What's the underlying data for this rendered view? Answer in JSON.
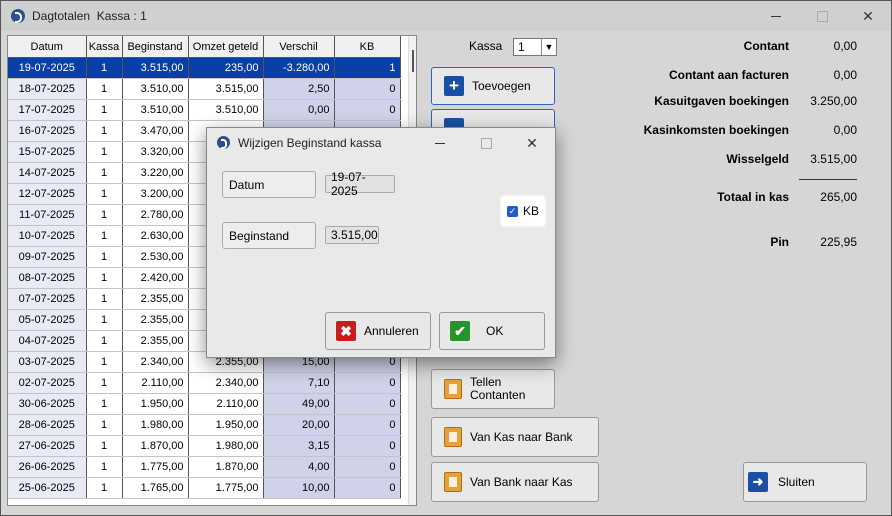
{
  "window": {
    "title": "Dagtotalen",
    "subtitle": "Kassa : 1",
    "minimize_symbol": "—",
    "maximize_symbol": "☐",
    "close_symbol": "✕"
  },
  "grid": {
    "columns": [
      "Datum",
      "Kassa",
      "Beginstand",
      "Omzet geteld",
      "Verschil",
      "KB"
    ],
    "rows": [
      [
        "19-07-2025",
        "1",
        "3.515,00",
        "235,00",
        "-3.280,00",
        "1"
      ],
      [
        "18-07-2025",
        "1",
        "3.510,00",
        "3.515,00",
        "2,50",
        "0"
      ],
      [
        "17-07-2025",
        "1",
        "3.510,00",
        "3.510,00",
        "0,00",
        "0"
      ],
      [
        "16-07-2025",
        "1",
        "3.470,00",
        "",
        "",
        ""
      ],
      [
        "15-07-2025",
        "1",
        "3.320,00",
        "",
        "",
        ""
      ],
      [
        "14-07-2025",
        "1",
        "3.220,00",
        "",
        "",
        ""
      ],
      [
        "12-07-2025",
        "1",
        "3.200,00",
        "",
        "",
        ""
      ],
      [
        "11-07-2025",
        "1",
        "2.780,00",
        "",
        "",
        ""
      ],
      [
        "10-07-2025",
        "1",
        "2.630,00",
        "",
        "",
        ""
      ],
      [
        "09-07-2025",
        "1",
        "2.530,00",
        "",
        "",
        ""
      ],
      [
        "08-07-2025",
        "1",
        "2.420,00",
        "",
        "",
        ""
      ],
      [
        "07-07-2025",
        "1",
        "2.355,00",
        "",
        "",
        ""
      ],
      [
        "05-07-2025",
        "1",
        "2.355,00",
        "",
        "",
        ""
      ],
      [
        "04-07-2025",
        "1",
        "2.355,00",
        "",
        "",
        ""
      ],
      [
        "03-07-2025",
        "1",
        "2.340,00",
        "2.355,00",
        "15,00",
        "0"
      ],
      [
        "02-07-2025",
        "1",
        "2.110,00",
        "2.340,00",
        "7,10",
        "0"
      ],
      [
        "30-06-2025",
        "1",
        "1.950,00",
        "2.110,00",
        "49,00",
        "0"
      ],
      [
        "28-06-2025",
        "1",
        "1.980,00",
        "1.950,00",
        "20,00",
        "0"
      ],
      [
        "27-06-2025",
        "1",
        "1.870,00",
        "1.980,00",
        "3,15",
        "0"
      ],
      [
        "26-06-2025",
        "1",
        "1.775,00",
        "1.870,00",
        "4,00",
        "0"
      ],
      [
        "25-06-2025",
        "1",
        "1.765,00",
        "1.775,00",
        "10,00",
        "0"
      ]
    ]
  },
  "kassa_select": {
    "label": "Kassa",
    "value": "1"
  },
  "buttons": {
    "toevoegen": "Toevoegen",
    "tellen_line1": "Tellen",
    "tellen_line2": "Contanten",
    "kas_naar_bank": "Van Kas naar Bank",
    "bank_naar_kas": "Van Bank naar Kas",
    "sluiten": "Sluiten"
  },
  "summary": [
    {
      "label": "Contant",
      "value": "0,00"
    },
    {
      "label": "Contant aan facturen",
      "value": "0,00"
    },
    {
      "label": "Kasuitgaven boekingen",
      "value": "3.250,00"
    },
    {
      "label": "Kasinkomsten boekingen",
      "value": "0,00"
    },
    {
      "label": "Wisselgeld",
      "value": "3.515,00"
    },
    {
      "label": "Totaal in kas",
      "value": "265,00"
    },
    {
      "label": "Pin",
      "value": "225,95"
    }
  ],
  "dialog": {
    "title": "Wijzigen Beginstand kassa",
    "datum_label": "Datum",
    "datum_value": "19-07-2025",
    "beginstand_label": "Beginstand",
    "beginstand_value": "3.515,00",
    "kb_label": "KB",
    "kb_checked": true,
    "annuleren": "Annuleren",
    "ok": "OK"
  }
}
